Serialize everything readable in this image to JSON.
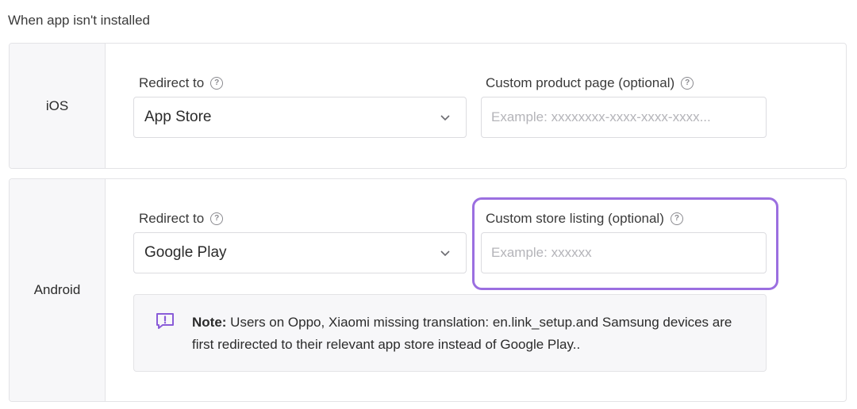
{
  "section_heading": "When app isn't installed",
  "ios": {
    "platform_label": "iOS",
    "redirect_label": "Redirect to",
    "redirect_value": "App Store",
    "custom_label": "Custom product page (optional)",
    "custom_placeholder": "Example: xxxxxxxx-xxxx-xxxx-xxxx..."
  },
  "android": {
    "platform_label": "Android",
    "redirect_label": "Redirect to",
    "redirect_value": "Google Play",
    "custom_label": "Custom store listing (optional)",
    "custom_placeholder": "Example: xxxxxx",
    "note_prefix": "Note:",
    "note_text": " Users on Oppo, Xiaomi missing translation: en.link_setup.and Samsung devices are first redirected to their relevant app store instead of Google Play.."
  },
  "icons": {
    "help": "help-circle-icon",
    "chevron": "chevron-down-icon",
    "note": "message-alert-icon"
  },
  "colors": {
    "highlight": "#9b6fe0",
    "note_icon": "#8a5cd8"
  }
}
